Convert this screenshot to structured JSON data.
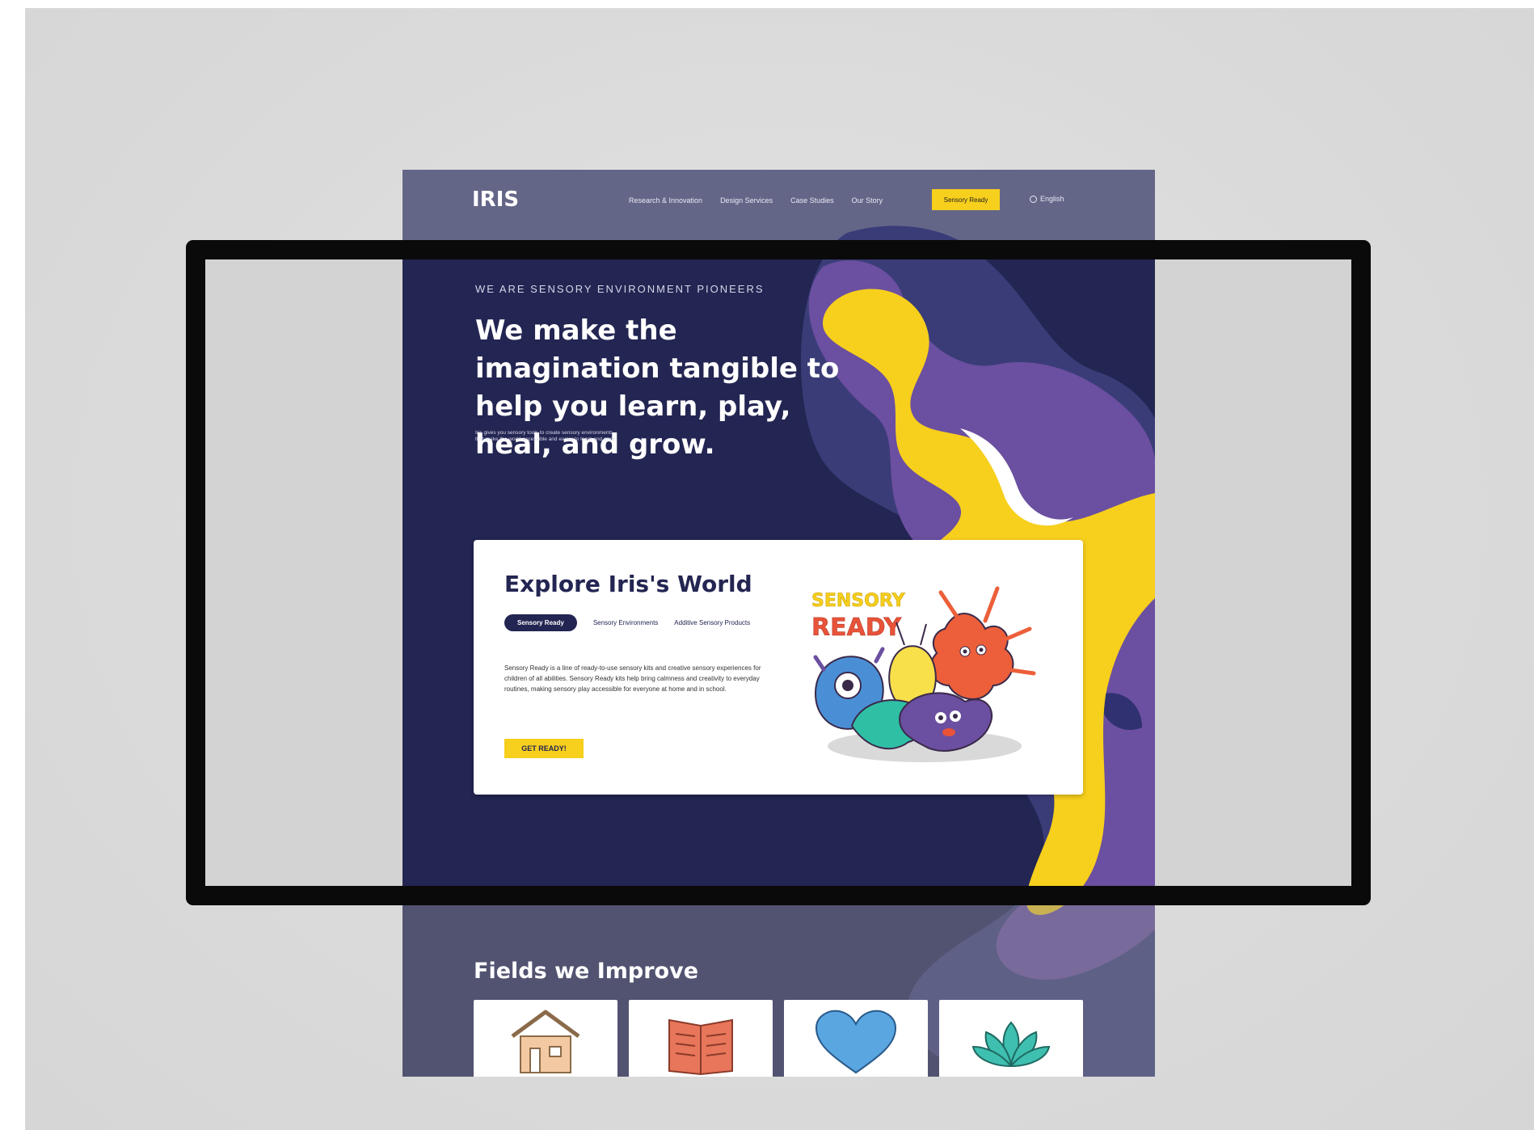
{
  "brand": {
    "logo": "IRIS"
  },
  "nav": {
    "items": [
      "Research & Innovation",
      "Design Services",
      "Case Studies",
      "Our Story"
    ],
    "cta": "Sensory Ready",
    "language": "English"
  },
  "hero": {
    "eyebrow": "WE ARE SENSORY ENVIRONMENT PIONEERS",
    "headline": "We make the imagination tangible to help you learn, play, heal, and grow.",
    "subtext": "Iris gives you sensory tools to create sensory environments that make the world accessible and easier to learn and grow."
  },
  "explore": {
    "title": "Explore Iris's World",
    "tabs": [
      "Sensory Ready",
      "Sensory Environments",
      "Additive Sensory Products"
    ],
    "active_tab": "Sensory Ready",
    "body": "Sensory Ready is a line of ready-to-use sensory kits and creative sensory experiences for children of all abilities. Sensory Ready kits help bring calmness and creativity to everyday routines, making sensory play accessible for everyone at home and in school.",
    "button": "GET READY!",
    "art_text_1": "SENSORY",
    "art_text_2": "READY"
  },
  "fields": {
    "title": "Fields we Improve",
    "items": [
      {
        "icon": "house-icon"
      },
      {
        "icon": "book-icon"
      },
      {
        "icon": "heart-icon"
      },
      {
        "icon": "lotus-icon"
      }
    ]
  },
  "colors": {
    "navy": "#232552",
    "purple": "#6c4fa0",
    "yellow": "#f7cf1d",
    "nav_band": "#646688"
  }
}
